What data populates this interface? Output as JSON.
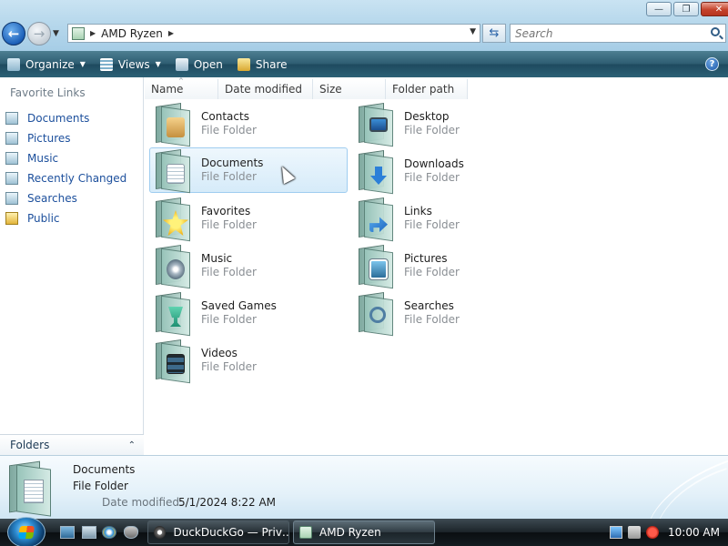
{
  "window": {
    "title": "AMD Ryzen",
    "controls": {
      "minimize": "—",
      "maximize": "❐",
      "close": "✕"
    }
  },
  "nav": {
    "back_glyph": "←",
    "forward_glyph": "→",
    "dropdown_glyph": "▼"
  },
  "address": {
    "separator": "▶",
    "location": "AMD Ryzen",
    "trailing_separator": "▶",
    "dropdown_glyph": "▼",
    "refresh_glyph": "⇆"
  },
  "search": {
    "placeholder": "Search"
  },
  "toolbar": {
    "organize": "Organize",
    "views": "Views",
    "open": "Open",
    "share": "Share",
    "dropdown_glyph": "▼",
    "help_glyph": "?"
  },
  "sidebar": {
    "title": "Favorite Links",
    "items": [
      {
        "label": "Documents",
        "icon": "documents-icon"
      },
      {
        "label": "Pictures",
        "icon": "pictures-icon"
      },
      {
        "label": "Music",
        "icon": "music-icon"
      },
      {
        "label": "Recently Changed",
        "icon": "recently-changed-icon"
      },
      {
        "label": "Searches",
        "icon": "searches-icon"
      },
      {
        "label": "Public",
        "icon": "public-folder-icon"
      }
    ],
    "folders_label": "Folders",
    "folders_chevron": "⌃"
  },
  "columns": {
    "name": "Name",
    "date": "Date modified",
    "size": "Size",
    "path": "Folder path",
    "sort_glyph": "^"
  },
  "files": [
    {
      "name": "Contacts",
      "type": "File Folder"
    },
    {
      "name": "Desktop",
      "type": "File Folder"
    },
    {
      "name": "Documents",
      "type": "File Folder"
    },
    {
      "name": "Downloads",
      "type": "File Folder"
    },
    {
      "name": "Favorites",
      "type": "File Folder"
    },
    {
      "name": "Links",
      "type": "File Folder"
    },
    {
      "name": "Music",
      "type": "File Folder"
    },
    {
      "name": "Pictures",
      "type": "File Folder"
    },
    {
      "name": "Saved Games",
      "type": "File Folder"
    },
    {
      "name": "Searches",
      "type": "File Folder"
    },
    {
      "name": "Videos",
      "type": "File Folder"
    }
  ],
  "selected_index": 2,
  "details": {
    "name": "Documents",
    "type": "File Folder",
    "date_label": "Date modified:",
    "date_value": "5/1/2024 8:22 AM"
  },
  "taskbar": {
    "tasks": [
      {
        "label": "DuckDuckGo — Priv…",
        "icon": "duckduckgo-icon"
      },
      {
        "label": "AMD Ryzen",
        "icon": "explorer-icon"
      }
    ],
    "clock": "10:00 AM"
  },
  "colors": {
    "accent": "#1c4f9c",
    "command_bar": "#2e5d72",
    "selection": "#d6ebf9"
  }
}
